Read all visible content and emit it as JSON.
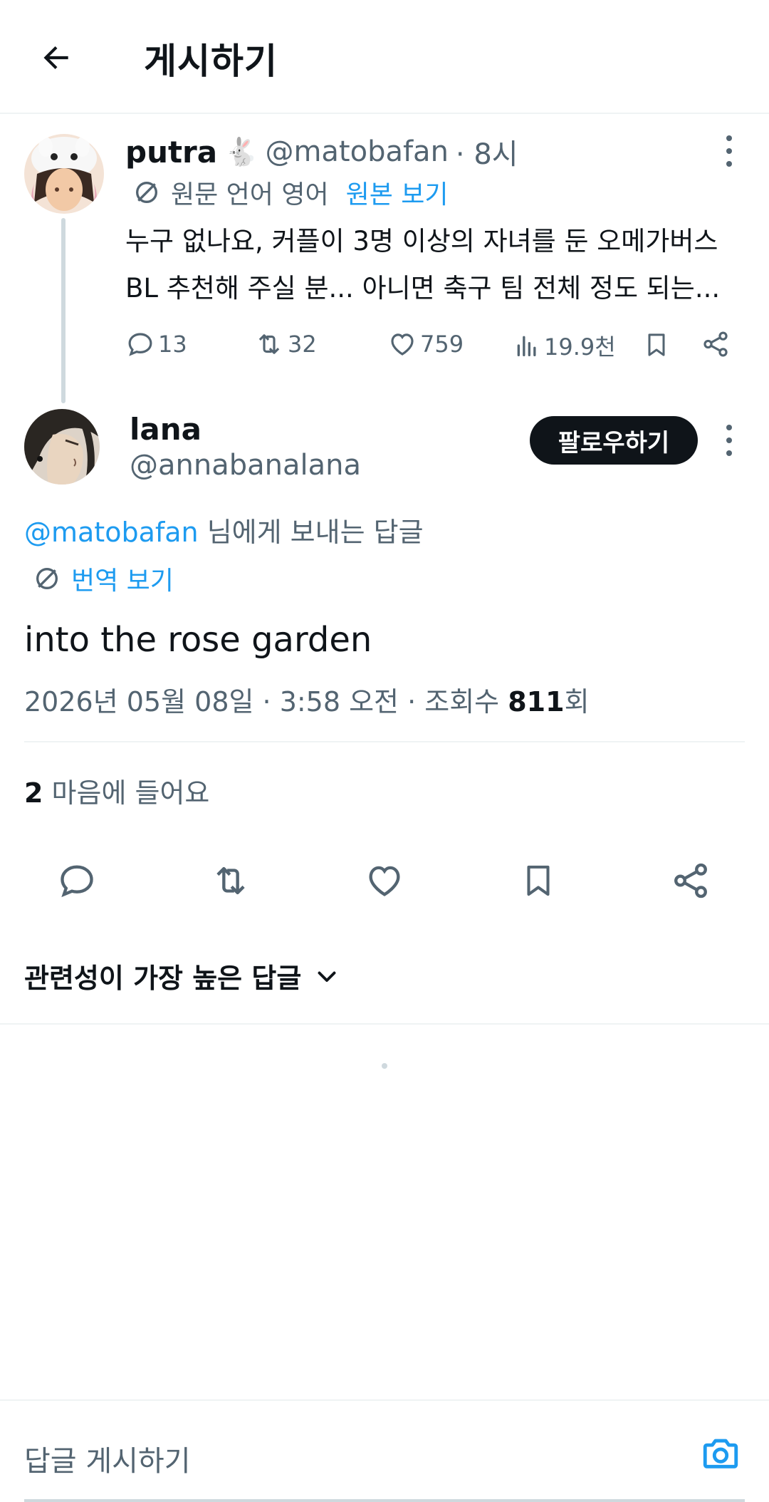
{
  "header": {
    "title": "게시하기"
  },
  "parent_tweet": {
    "name": "putra",
    "name_emoji": "🐇",
    "handle": "@matobafan",
    "time": "· 8시",
    "original_language": "원문 언어 영어",
    "show_original": "원본 보기",
    "text_line1": "누구 없나요, 커플이 3명 이상의 자녀를 둔 오메가버스",
    "text_line2": "BL 추천해 주실 분... 아니면 축구 팀 전체 정도 되는...",
    "replies": "13",
    "reposts": "32",
    "likes": "759",
    "views": "19.9천"
  },
  "reply_tweet": {
    "name": "lana",
    "handle": "@annabanalana",
    "follow_label": "팔로우하기",
    "reply_to_handle": "@matobafan",
    "reply_to_suffix": " 님에게 보내는 답글",
    "translate_label": "번역 보기",
    "text": "into the rose garden",
    "timestamp": "2026년 05월 08일 · 3:58 오전 · 조회수 ",
    "views_count": "811",
    "views_suffix": "회",
    "likes_count": "2",
    "likes_label": " 마음에 들어요"
  },
  "sort": {
    "label": "관련성이 가장 높은 답글"
  },
  "composer": {
    "placeholder": "답글 게시하기"
  },
  "colors": {
    "accent": "#1d9bf0",
    "text": "#0f1419",
    "muted": "#536471",
    "border": "#eff3f4"
  },
  "icons": [
    "back-arrow-icon",
    "translate-icon",
    "reply-icon",
    "repost-icon",
    "like-icon",
    "views-icon",
    "bookmark-icon",
    "share-icon",
    "more-icon",
    "chevron-down-icon",
    "camera-icon"
  ]
}
